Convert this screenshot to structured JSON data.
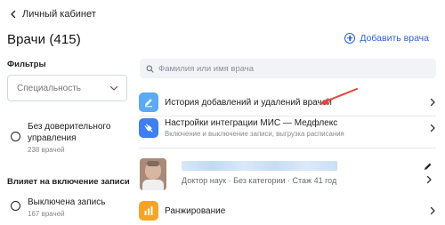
{
  "header": {
    "back_label": "Личный кабинет",
    "title": "Врачи (415)",
    "add_label": "Добавить врача"
  },
  "filters": {
    "heading": "Фильтры",
    "specialty_placeholder": "Специальность",
    "trust": {
      "label": "Без доверительного управления",
      "count": "238 врачей"
    },
    "booking_heading": "Влияет на включение записи",
    "booking": {
      "label": "Выключена запись",
      "count": "167 врачей"
    }
  },
  "search": {
    "placeholder": "Фамилия или имя врача"
  },
  "menu": {
    "history": {
      "title": "История добавлений и удалений врачей",
      "icon": "pencil-icon",
      "color": "#5aaaf5"
    },
    "mis": {
      "title": "Настройки интеграции МИС — Медфлекс",
      "subtitle": "Включение и выключение записи, выгрузка расписания",
      "icon": "plug-icon",
      "color": "#3d7ff0"
    },
    "ranking": {
      "title": "Ранжирование",
      "icon": "bar-chart-icon",
      "color": "#f5a524"
    }
  },
  "doctor": {
    "meta": "Доктор наук  ·  Без категории  ·  Стаж 41 год"
  },
  "colors": {
    "accent": "#2f5fd3",
    "annotation_arrow": "#e8443a"
  }
}
